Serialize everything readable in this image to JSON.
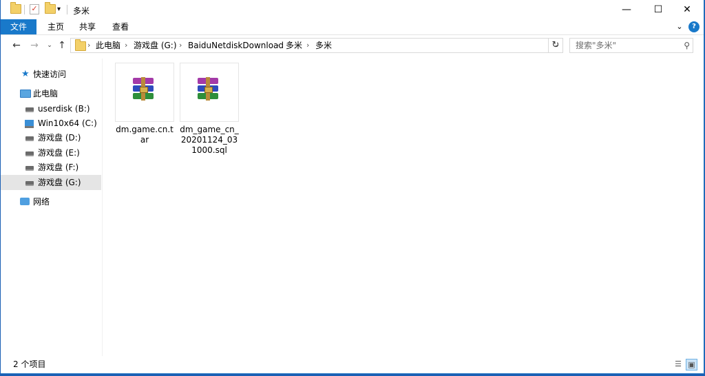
{
  "window": {
    "title": "多米"
  },
  "title_controls": {
    "minimize": "—",
    "maximize": "☐",
    "close": "✕"
  },
  "ribbon": {
    "tabs": [
      "文件",
      "主页",
      "共享",
      "查看"
    ]
  },
  "address": {
    "crumbs": [
      "此电脑",
      "游戏盘 (G:)",
      "BaiduNetdiskDownload",
      "多米",
      "多米"
    ],
    "search_placeholder": "搜索\"多米\""
  },
  "nav_pane": {
    "quick_access": "快速访问",
    "this_pc": "此电脑",
    "drives": [
      {
        "label": "userdisk (B:)",
        "icon": "drive-icon"
      },
      {
        "label": "Win10x64 (C:)",
        "icon": "windows-drive-icon"
      },
      {
        "label": "游戏盘 (D:)",
        "icon": "drive-icon"
      },
      {
        "label": "游戏盘 (E:)",
        "icon": "drive-icon"
      },
      {
        "label": "游戏盘 (F:)",
        "icon": "drive-icon"
      },
      {
        "label": "游戏盘 (G:)",
        "icon": "drive-icon",
        "selected": true
      }
    ],
    "network": "网络"
  },
  "files": [
    {
      "name": "dm.game.cn.tar",
      "icon": "winrar-archive-icon"
    },
    {
      "name": "dm_game_cn_20201124_031000.sql",
      "icon": "winrar-archive-icon"
    }
  ],
  "status": {
    "item_count": "2 个项目"
  }
}
